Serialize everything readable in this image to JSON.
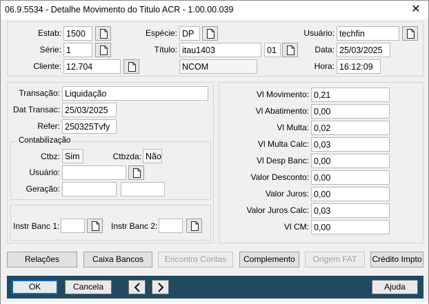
{
  "window": {
    "title": "06.9.5534 - Detalhe Movimento do Titulo ACR - 1.00.00.039",
    "close_glyph": "✕"
  },
  "header": {
    "estab_label": "Estab:",
    "estab_value": "1500",
    "especie_label": "Espécie:",
    "especie_value": "DP",
    "usuario_label": "Usuário:",
    "usuario_value": "techfin",
    "serie_label": "Série:",
    "serie_value": "1",
    "titulo_label": "Título:",
    "titulo_value": "itau1403",
    "parcela_value": "01",
    "data_label": "Data:",
    "data_value": "25/03/2025",
    "cliente_label": "Cliente:",
    "cliente_value": "12.704",
    "nome_value": "NCOM",
    "hora_label": "Hora:",
    "hora_value": "16:12:09"
  },
  "movimento": {
    "transacao_label": "Transação:",
    "transacao_value": "Liquidação",
    "dat_transac_label": "Dat Transac:",
    "dat_transac_value": "25/03/2025",
    "refer_label": "Refer:",
    "refer_value": "250325Tvfy"
  },
  "contabilizacao": {
    "legend": "Contabilização",
    "ctbz_label": "Ctbz:",
    "ctbz_value": "Sim",
    "ctbzda_label": "Ctbzda:",
    "ctbzda_value": "Não",
    "usuario_label": "Usuário:",
    "usuario_value": "",
    "geracao_label": "Geração:",
    "geracao_value": "",
    "geracao_value2": ""
  },
  "instr": {
    "banc1_label": "Instr Banc 1:",
    "banc1_value": "",
    "banc2_label": "Instr Banc 2:",
    "banc2_value": ""
  },
  "valores": [
    {
      "label": "Vl Movimento:",
      "value": "0,21"
    },
    {
      "label": "Vl Abatimento:",
      "value": "0,00"
    },
    {
      "label": "Vl Multa:",
      "value": "0,02"
    },
    {
      "label": "Vl Multa Calc:",
      "value": "0,03"
    },
    {
      "label": "Vl Desp Banc:",
      "value": "0,00"
    },
    {
      "label": "Valor Desconto:",
      "value": "0,00"
    },
    {
      "label": "Valor Juros:",
      "value": "0,00"
    },
    {
      "label": "Valor Juros Calc:",
      "value": "0,03"
    },
    {
      "label": "Vl CM:",
      "value": "0,00"
    }
  ],
  "actions": {
    "relacoes": "Relações",
    "caixa_bancos": "Caixa Bancos",
    "encontro_contas": "Encontro Contas",
    "complemento": "Complemento",
    "origem_fat": "Origem FAT",
    "credito_impto": "Crédito Impto"
  },
  "footer": {
    "ok": "OK",
    "cancela": "Cancela",
    "ajuda": "Ajuda"
  },
  "icons": {
    "zoom": "document-icon",
    "prev": "chevron-left-icon",
    "next": "chevron-right-icon"
  },
  "colors": {
    "bottom_bar": "#1f4a5f",
    "primary_border": "#0a66c2"
  }
}
